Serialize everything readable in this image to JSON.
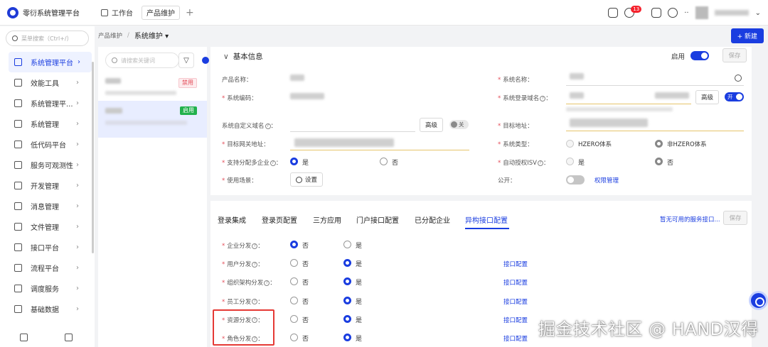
{
  "app": {
    "name": "零衍系统管理平台"
  },
  "top_tabs": [
    {
      "label": "工作台"
    },
    {
      "label": "产品维护"
    }
  ],
  "notifications": {
    "count": "13"
  },
  "sidebar": {
    "search_placeholder": "菜单搜索（Ctrl+/）",
    "items": [
      {
        "label": "系统管理平台",
        "icon": "grid-icon"
      },
      {
        "label": "效能工具",
        "icon": "tool-icon"
      },
      {
        "label": "系统管理平...",
        "icon": "system-icon"
      },
      {
        "label": "系统管理",
        "icon": "cube-icon"
      },
      {
        "label": "低代码平台",
        "icon": "code-icon"
      },
      {
        "label": "服务可观测性",
        "icon": "monitor-icon"
      },
      {
        "label": "开发管理",
        "icon": "dev-icon"
      },
      {
        "label": "消息管理",
        "icon": "message-icon"
      },
      {
        "label": "文件管理",
        "icon": "file-icon"
      },
      {
        "label": "接口平台",
        "icon": "api-icon"
      },
      {
        "label": "流程平台",
        "icon": "flow-icon"
      },
      {
        "label": "调度服务",
        "icon": "schedule-icon"
      },
      {
        "label": "基础数据",
        "icon": "data-icon"
      }
    ]
  },
  "breadcrumb": {
    "parent": "产品维护",
    "current": "系统维护 ▾"
  },
  "toolbar": {
    "new_label": "+ 新建"
  },
  "list": {
    "search_placeholder": "请搜索关键词",
    "items": [
      {
        "status": "禁用"
      },
      {
        "status": "启用"
      }
    ]
  },
  "basic_info": {
    "title": "基本信息",
    "enable_label": "启用",
    "save_label": "保存",
    "fields": {
      "product_name": "产品名称：",
      "system_name": "系统名称：",
      "system_code": "系统编码：",
      "login_domain": "系统登录域名",
      "custom_domain": "系统自定义域名",
      "target_addr": "目标地址：",
      "gateway_addr": "目标网关地址：",
      "system_type": "系统类型：",
      "multi_tenant": "支持分配多企业",
      "auto_isv": "自动授权ISV",
      "usage": "使用场景：",
      "public": "公开："
    },
    "advanced_label": "高级",
    "toggle_on": "开",
    "toggle_off": "关",
    "type_options": [
      "HZERO体系",
      "非HZERO体系"
    ],
    "yes": "是",
    "no": "否",
    "settings_label": "设置",
    "permission_link": "权限管理"
  },
  "config_tabs": {
    "tabs": [
      "登录集成",
      "登录页配置",
      "三方应用",
      "门户接口配置",
      "已分配企业",
      "异构接口配置"
    ],
    "active": "异构接口配置",
    "unavailable_link": "暂无可用的服务接口...",
    "save_label": "保存"
  },
  "distribution": {
    "rows": [
      {
        "label": "企业分发",
        "value": "no",
        "link": ""
      },
      {
        "label": "用户分发",
        "value": "yes",
        "link": "接口配置"
      },
      {
        "label": "组织架构分发",
        "value": "yes",
        "link": "接口配置"
      },
      {
        "label": "员工分发",
        "value": "yes",
        "link": "接口配置"
      },
      {
        "label": "资源分发",
        "value": "yes",
        "link": "接口配置"
      },
      {
        "label": "角色分发",
        "value": "yes",
        "link": "接口配置"
      }
    ]
  },
  "watermark": "掘金技术社区 @ HAND汉得",
  "colors": {
    "primary": "#1a3de0",
    "danger": "#e34d59",
    "success": "#22b14c"
  }
}
